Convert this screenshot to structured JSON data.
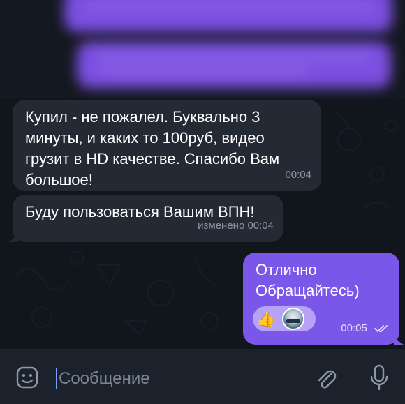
{
  "messages": [
    {
      "direction": "incoming",
      "text": "Купил - не пожалел. Буквально 3\nминуты, и каких то 100руб, видео\nгрузит в  HD качестве. Спасибо Вам\nбольшое!",
      "time": "00:04"
    },
    {
      "direction": "incoming",
      "text": "Буду пользоваться Вашим ВПН!",
      "time": "изменено 00:04"
    },
    {
      "direction": "outgoing",
      "text": "Отлично\nОбращайтесь)",
      "time": "00:05",
      "reaction_emoji": "👍",
      "read_icon": "double-check-icon"
    }
  ],
  "composer": {
    "placeholder": "Сообщение",
    "emoji_icon": "emoji-face-icon",
    "attach_icon": "paperclip-icon",
    "mic_icon": "microphone-icon"
  },
  "colors": {
    "background": "#11151c",
    "incoming_bubble": "#242a33",
    "outgoing_bubble": "#7a57e8",
    "composer": "#1c222b"
  }
}
